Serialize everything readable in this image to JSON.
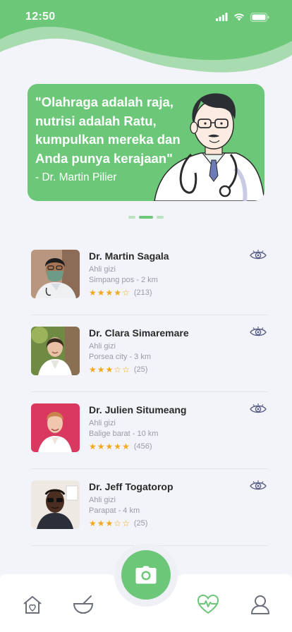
{
  "status": {
    "time": "12:50"
  },
  "banner": {
    "quote": "\"Olahraga adalah raja, nutrisi adalah Ratu, kumpulkan mereka dan Anda punya kerajaan\"",
    "author": "- Dr. Martin Pilier"
  },
  "doctors": [
    {
      "name": "Dr. Martin Sagala",
      "role": "Ahli gizi",
      "location": "Simpang pos - 2 km",
      "rating": 4,
      "count": "(213)"
    },
    {
      "name": "Dr. Clara Simaremare",
      "role": "Ahli gizi",
      "location": "Porsea city - 3 km",
      "rating": 3,
      "count": "(25)"
    },
    {
      "name": "Dr. Julien Situmeang",
      "role": "Ahli gizi",
      "location": "Balige barat - 10 km",
      "rating": 5,
      "count": "(456)"
    },
    {
      "name": "Dr. Jeff Togatorop",
      "role": "Ahli gizi",
      "location": "Parapat - 4 km",
      "rating": 3,
      "count": "(25)"
    }
  ],
  "nav": {
    "items": [
      "home-icon",
      "bowl-icon",
      "camera-icon",
      "heart-pulse-icon",
      "profile-icon"
    ],
    "active": "heart-pulse-icon"
  },
  "colors": {
    "accent": "#6cc779",
    "star": "#f2a81d",
    "muted": "#9a9ba6",
    "eye": "#5a5f86"
  }
}
